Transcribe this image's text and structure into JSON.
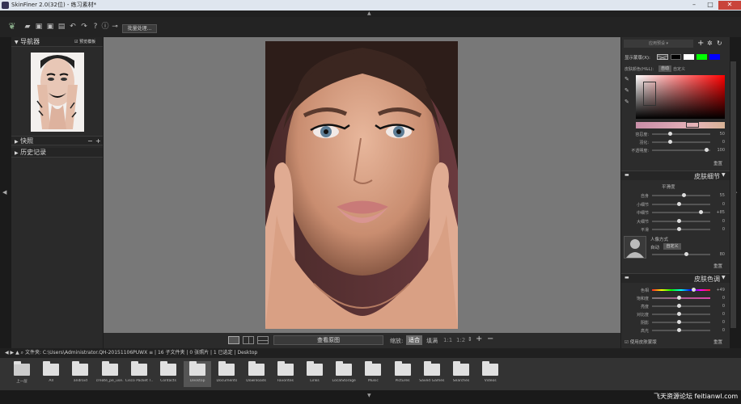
{
  "window": {
    "title": "SkinFiner 2.0(32位) - 练习素材*"
  },
  "toolbar": {
    "batch_label": "批量处理..."
  },
  "left": {
    "navigator_label": "导航器",
    "preview_label": "预览模板",
    "snapshot_label": "快照",
    "history_label": "历史记录"
  },
  "canvas": {
    "view_original": "查看原图",
    "zoom_label": "缩放:",
    "fit": "适合",
    "fill": "填满",
    "one_to_one": "1:1",
    "ratio": "1:2"
  },
  "right": {
    "preset_label": "应用预设",
    "display_mask_label": "显示蒙版(X):",
    "skin_color_label": "皮肤颜色(H&L):",
    "auto_label": "自动",
    "custom_label": "自定义",
    "color_sliders": [
      {
        "label": "容忍度:",
        "value": "50",
        "pos": 0.3
      },
      {
        "label": "羽化:",
        "value": "0",
        "pos": 0.3
      },
      {
        "label": "不透明度:",
        "value": "100",
        "pos": 0.95
      }
    ],
    "reset_label": "重置",
    "detail_title": "皮肤细节",
    "smooth_label": "平滑度",
    "detail_sliders": [
      {
        "label": "自身",
        "value": "55",
        "pos": 0.55
      },
      {
        "label": "小细节",
        "value": "0",
        "pos": 0.45
      },
      {
        "label": "中细节",
        "value": "+85",
        "pos": 0.85
      },
      {
        "label": "大细节",
        "value": "0",
        "pos": 0.45
      },
      {
        "label": "平滑",
        "value": "0",
        "pos": 0.45
      }
    ],
    "portrait_label": "人像方式",
    "portrait_auto": "自动",
    "portrait_custom": "自定义",
    "portrait_value": "80",
    "tone_title": "皮肤色调",
    "tone_sliders": [
      {
        "label": "色相",
        "value": "+49",
        "pos": 0.72,
        "grad": "hue"
      },
      {
        "label": "饱和度",
        "value": "0",
        "pos": 0.45,
        "grad": "sat"
      },
      {
        "label": "亮度",
        "value": "0",
        "pos": 0.45
      },
      {
        "label": "对比度",
        "value": "0",
        "pos": 0.45
      },
      {
        "label": "阴影",
        "value": "0",
        "pos": 0.45
      },
      {
        "label": "高光",
        "value": "0",
        "pos": 0.45
      }
    ],
    "use_mask_label": "使用皮肤蒙版"
  },
  "path": {
    "label": "文件夹:",
    "value": "C:\\Users\\Administrator.QH-20151106PUWX ≡ | 16 子文件夹 | 0 张照片 | 1 已选定 | Desktop"
  },
  "folders": [
    "上一层",
    "All",
    "android",
    "create_pe_use...",
    "Cisco Packet T...",
    "Contacts",
    "Desktop",
    "Documents",
    "Downloads",
    "Favorites",
    "Links",
    "LocalStorage",
    "Music",
    "Pictures",
    "Saved Games",
    "Searches",
    "Videos"
  ],
  "watermark": "飞天资源论坛 feitianwl.com",
  "colors": {
    "mask_swatches": [
      "#000000",
      "#ffffff",
      "#00ff00",
      "#0000ff"
    ],
    "skin_strip": "#c98fa8"
  }
}
